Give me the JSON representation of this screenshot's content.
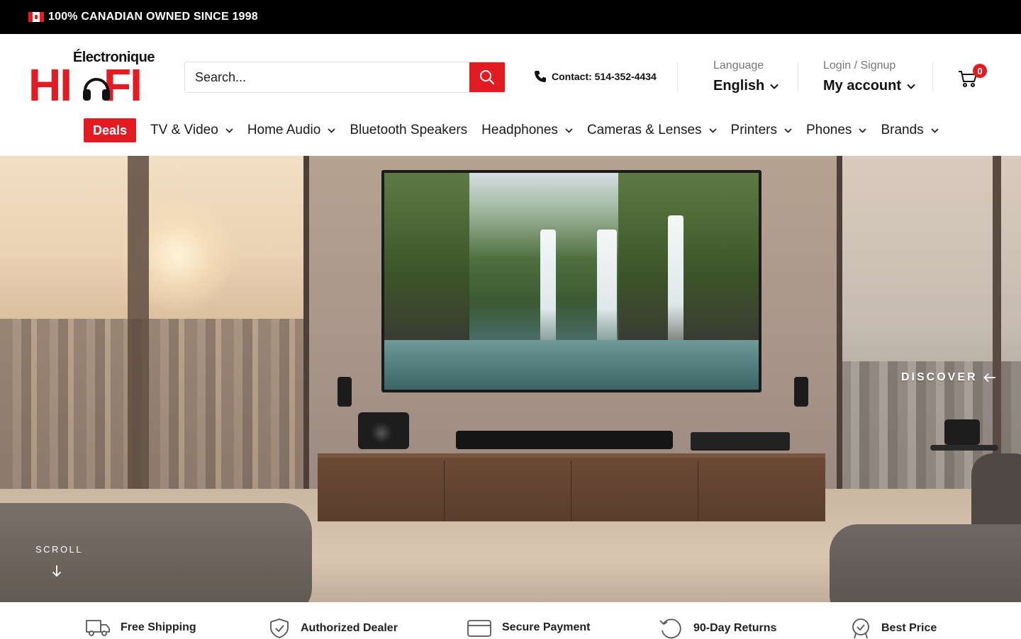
{
  "announcement": {
    "text": "100% CANADIAN OWNED SINCE 1998"
  },
  "logo": {
    "sub": "Électronique",
    "main_left": "HI",
    "main_right": "FI"
  },
  "search": {
    "placeholder": "Search..."
  },
  "contact": {
    "label": "Contact: 514-352-4434"
  },
  "language": {
    "label": "Language",
    "value": "English"
  },
  "account": {
    "label": "Login / Signup",
    "value": "My account"
  },
  "cart": {
    "count": "0"
  },
  "nav": {
    "deals": "Deals",
    "items": [
      {
        "label": "TV & Video"
      },
      {
        "label": "Home Audio"
      },
      {
        "label": "Bluetooth Speakers"
      },
      {
        "label": "Headphones"
      },
      {
        "label": "Cameras & Lenses"
      },
      {
        "label": "Printers"
      },
      {
        "label": "Phones"
      },
      {
        "label": "Brands"
      }
    ]
  },
  "hero": {
    "discover": "DISCOVER",
    "scroll": "SCROLL"
  },
  "features": [
    {
      "label": "Free Shipping",
      "icon": "truck-icon"
    },
    {
      "label": "Authorized Dealer",
      "icon": "shield-check-icon"
    },
    {
      "label": "Secure Payment",
      "icon": "credit-card-icon"
    },
    {
      "label": "90-Day Returns",
      "icon": "returns-icon"
    },
    {
      "label": "Best Price",
      "icon": "badge-check-icon"
    }
  ],
  "colors": {
    "brand_red": "#e31b23",
    "topbar_bg": "#000000"
  }
}
